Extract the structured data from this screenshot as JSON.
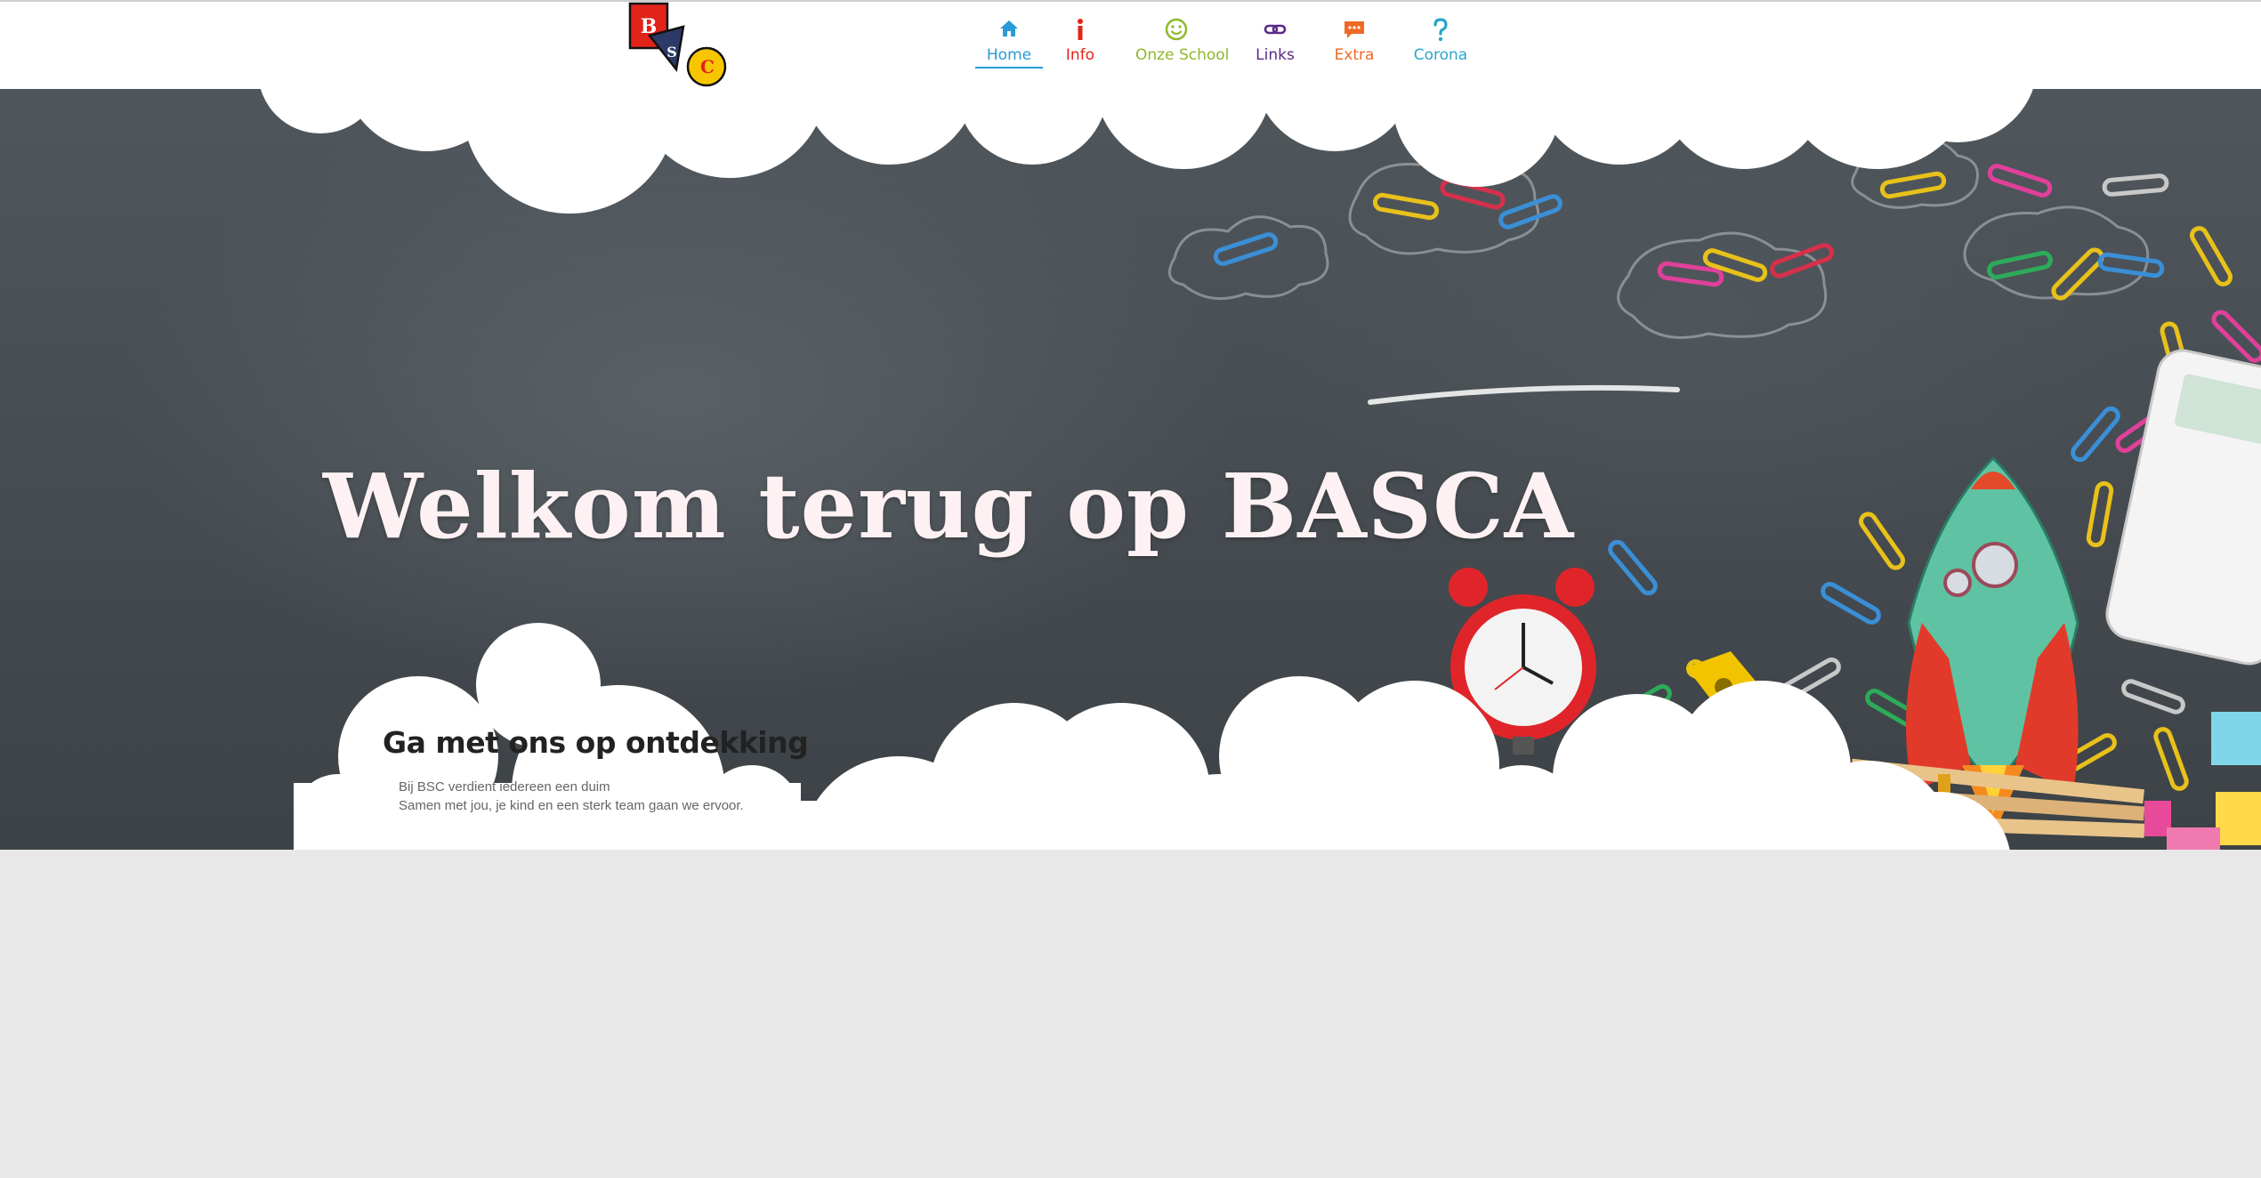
{
  "logo": {
    "letters": [
      "B",
      "S",
      "C"
    ],
    "colors": {
      "red": "#e2231a",
      "navy": "#2b3a67",
      "yellow": "#f7c600"
    }
  },
  "nav": {
    "items": [
      {
        "label": "Home",
        "icon": "home-icon",
        "color": "#2a9bd6",
        "active": true
      },
      {
        "label": "Info",
        "icon": "info-icon",
        "color": "#e2231a",
        "active": false
      },
      {
        "label": "Onze School",
        "icon": "smiley-icon",
        "color": "#8fb82a",
        "active": false
      },
      {
        "label": "Links",
        "icon": "link-icon",
        "color": "#5b2a86",
        "active": false
      },
      {
        "label": "Extra",
        "icon": "chat-icon",
        "color": "#f06a25",
        "active": false
      },
      {
        "label": "Corona",
        "icon": "question-icon",
        "color": "#2aa6c8",
        "active": false
      }
    ]
  },
  "hero": {
    "title": "Welkom terug op BASCA",
    "subtitle": "Ga met ons op ontdekking",
    "description_line1": "Bij BSC verdient iedereen een duim",
    "description_line2": "Samen met jou, je kind en een sterk team gaan we ervoor."
  },
  "colors": {
    "background": "#e8e8e8",
    "title_text": "#fdf1f3",
    "chalkboard": "#4a5055"
  }
}
